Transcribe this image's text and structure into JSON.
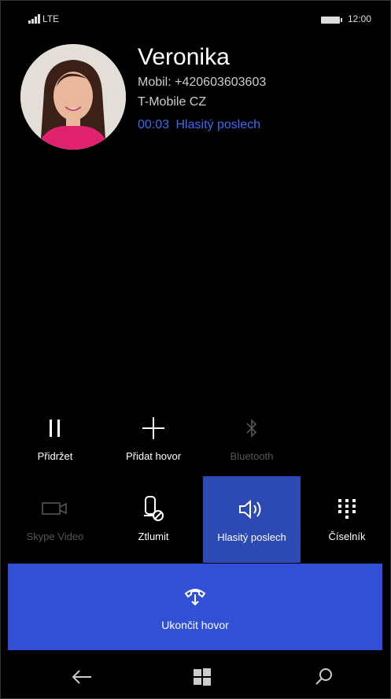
{
  "status_bar": {
    "network": "LTE",
    "time": "12:00"
  },
  "contact": {
    "name": "Veronika",
    "number_line": "Mobil: +420603603603",
    "carrier": "T-Mobile CZ",
    "timer": "00:03",
    "mode": "Hlasitý poslech"
  },
  "row1": [
    {
      "label": "Přidržet",
      "icon": "pause-icon",
      "enabled": true
    },
    {
      "label": "Přidat hovor",
      "icon": "plus-icon",
      "enabled": true
    },
    {
      "label": "Bluetooth",
      "icon": "bluetooth-icon",
      "enabled": false
    }
  ],
  "row2": [
    {
      "label": "Skype Video",
      "icon": "video-camera-icon",
      "enabled": false
    },
    {
      "label": "Ztlumit",
      "icon": "mute-phone-icon",
      "enabled": true
    },
    {
      "label": "Hlasitý poslech",
      "icon": "speaker-icon",
      "enabled": true,
      "active": true
    },
    {
      "label": "Číselník",
      "icon": "keypad-icon",
      "enabled": true
    }
  ],
  "end_call": {
    "label": "Ukončit hovor",
    "icon": "end-call-icon"
  },
  "navigation": {
    "back_icon": "back-arrow-icon",
    "home_icon": "windows-logo-icon",
    "search_icon": "search-icon"
  },
  "colors": {
    "accent": "#3150d6",
    "active_tile": "#2d49b3",
    "link_blue": "#3a6cf2"
  }
}
